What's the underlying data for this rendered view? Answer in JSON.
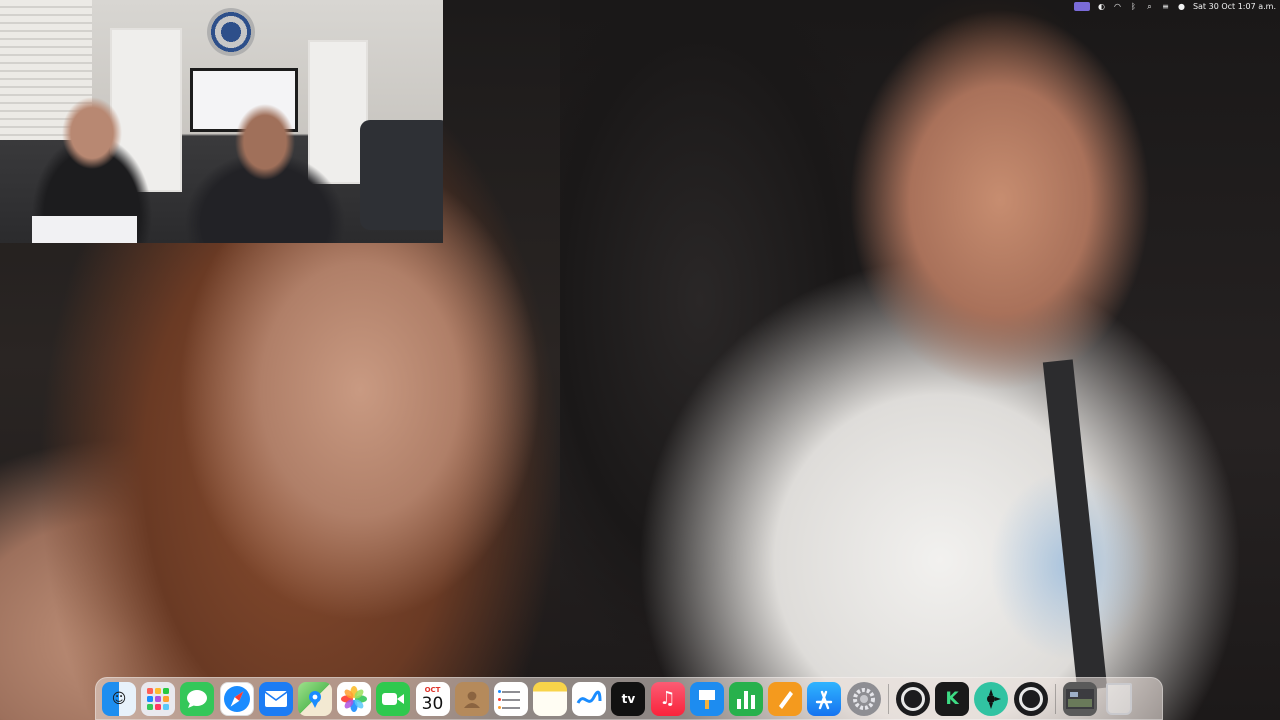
{
  "menubar": {
    "clock": "Sat 30 Oct 1:07 a.m.",
    "accent_color": "#7a6bd8"
  },
  "webcam": {
    "label": ""
  },
  "dock": {
    "items": [
      {
        "name": "finder",
        "icon": "finder-icon",
        "color": "#1e8ef0"
      },
      {
        "name": "launchpad",
        "icon": "launchpad-icon",
        "color": "#ff9f2e"
      },
      {
        "name": "messages",
        "icon": "messages-icon",
        "color": "#34c759"
      },
      {
        "name": "safari",
        "icon": "safari-icon",
        "color": "#1a8cff"
      },
      {
        "name": "mail",
        "icon": "mail-icon",
        "color": "#1c7cf4"
      },
      {
        "name": "maps",
        "icon": "maps-icon",
        "color": "#5fbf5a"
      },
      {
        "name": "photos",
        "icon": "photos-icon",
        "color": "#ffffff"
      },
      {
        "name": "facetime",
        "icon": "facetime-icon",
        "color": "#2fc94e"
      },
      {
        "name": "calendar",
        "icon": "calendar-icon",
        "month": "OCT",
        "day": "30"
      },
      {
        "name": "contacts",
        "icon": "contacts-icon",
        "color": "#b58a5b"
      },
      {
        "name": "reminders",
        "icon": "reminders-icon",
        "color": "#ffffff"
      },
      {
        "name": "notes",
        "icon": "notes-icon",
        "color": "#f8d44a"
      },
      {
        "name": "freeform",
        "icon": "freeform-icon",
        "color": "#ffffff"
      },
      {
        "name": "apple-tv",
        "icon": "appletv-icon",
        "color": "#111111",
        "label": "tv"
      },
      {
        "name": "music",
        "icon": "music-icon",
        "color": "#fa3e57"
      },
      {
        "name": "keynote",
        "icon": "keynote-icon",
        "color": "#1d8cf0"
      },
      {
        "name": "numbers",
        "icon": "numbers-icon",
        "color": "#28b14c"
      },
      {
        "name": "pages",
        "icon": "pages-icon",
        "color": "#f49a1e"
      },
      {
        "name": "app-store",
        "icon": "appstore-icon",
        "color": "#1a8cff"
      },
      {
        "name": "system-preferences",
        "icon": "gear-icon",
        "color": "#8e8e93"
      },
      {
        "name": "obs",
        "icon": "obs-icon",
        "color": "#1c1c1e"
      },
      {
        "name": "kick",
        "icon": "kick-icon",
        "color": "#1a1a1a",
        "label": "K"
      },
      {
        "name": "streamlabs",
        "icon": "streamlabs-icon",
        "color": "#31c3a2"
      },
      {
        "name": "obs-2",
        "icon": "obs-icon",
        "color": "#1c1c1e"
      },
      {
        "name": "game",
        "icon": "game-icon",
        "color": "#5a5a5a"
      },
      {
        "name": "trash",
        "icon": "trash-icon",
        "color": "#c9c9cd"
      }
    ]
  }
}
